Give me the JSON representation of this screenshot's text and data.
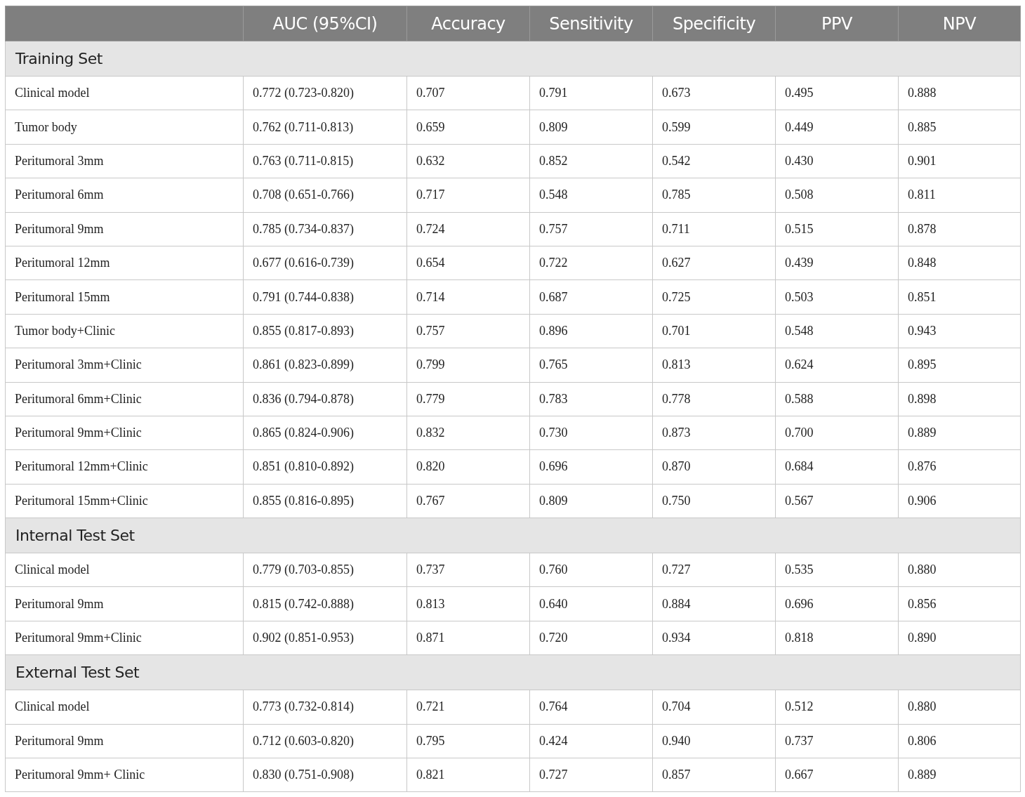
{
  "table": {
    "columns": [
      "AUC (95%CI)",
      "Accuracy",
      "Sensitivity",
      "Specificity",
      "PPV",
      "NPV"
    ],
    "sections": [
      {
        "title": "Training Set",
        "rows": [
          [
            "Clinical model",
            "0.772 (0.723-0.820)",
            "0.707",
            "0.791",
            "0.673",
            "0.495",
            "0.888"
          ],
          [
            "Tumor body",
            "0.762 (0.711-0.813)",
            "0.659",
            "0.809",
            "0.599",
            "0.449",
            "0.885"
          ],
          [
            "Peritumoral 3mm",
            "0.763 (0.711-0.815)",
            "0.632",
            "0.852",
            "0.542",
            "0.430",
            "0.901"
          ],
          [
            "Peritumoral 6mm",
            "0.708 (0.651-0.766)",
            "0.717",
            "0.548",
            "0.785",
            "0.508",
            "0.811"
          ],
          [
            "Peritumoral 9mm",
            "0.785 (0.734-0.837)",
            "0.724",
            "0.757",
            "0.711",
            "0.515",
            "0.878"
          ],
          [
            "Peritumoral 12mm",
            "0.677 (0.616-0.739)",
            "0.654",
            "0.722",
            "0.627",
            "0.439",
            "0.848"
          ],
          [
            "Peritumoral 15mm",
            "0.791 (0.744-0.838)",
            "0.714",
            "0.687",
            "0.725",
            "0.503",
            "0.851"
          ],
          [
            "Tumor body+Clinic",
            "0.855 (0.817-0.893)",
            "0.757",
            "0.896",
            "0.701",
            "0.548",
            "0.943"
          ],
          [
            "Peritumoral 3mm+Clinic",
            "0.861 (0.823-0.899)",
            "0.799",
            "0.765",
            "0.813",
            "0.624",
            "0.895"
          ],
          [
            "Peritumoral 6mm+Clinic",
            "0.836 (0.794-0.878)",
            "0.779",
            "0.783",
            "0.778",
            "0.588",
            "0.898"
          ],
          [
            "Peritumoral 9mm+Clinic",
            "0.865 (0.824-0.906)",
            "0.832",
            "0.730",
            "0.873",
            "0.700",
            "0.889"
          ],
          [
            "Peritumoral 12mm+Clinic",
            "0.851 (0.810-0.892)",
            "0.820",
            "0.696",
            "0.870",
            "0.684",
            "0.876"
          ],
          [
            "Peritumoral 15mm+Clinic",
            "0.855 (0.816-0.895)",
            "0.767",
            "0.809",
            "0.750",
            "0.567",
            "0.906"
          ]
        ]
      },
      {
        "title": "Internal Test Set",
        "rows": [
          [
            "Clinical model",
            "0.779 (0.703-0.855)",
            "0.737",
            "0.760",
            "0.727",
            "0.535",
            "0.880"
          ],
          [
            "Peritumoral 9mm",
            "0.815 (0.742-0.888)",
            "0.813",
            "0.640",
            "0.884",
            "0.696",
            "0.856"
          ],
          [
            "Peritumoral 9mm+Clinic",
            "0.902 (0.851-0.953)",
            "0.871",
            "0.720",
            "0.934",
            "0.818",
            "0.890"
          ]
        ]
      },
      {
        "title": "External Test Set",
        "rows": [
          [
            "Clinical model",
            "0.773 (0.732-0.814)",
            "0.721",
            "0.764",
            "0.704",
            "0.512",
            "0.880"
          ],
          [
            "Peritumoral 9mm",
            "0.712 (0.603-0.820)",
            "0.795",
            "0.424",
            "0.940",
            "0.737",
            "0.806"
          ],
          [
            "Peritumoral 9mm+ Clinic",
            "0.830 (0.751-0.908)",
            "0.821",
            "0.727",
            "0.857",
            "0.667",
            "0.889"
          ]
        ]
      }
    ]
  }
}
